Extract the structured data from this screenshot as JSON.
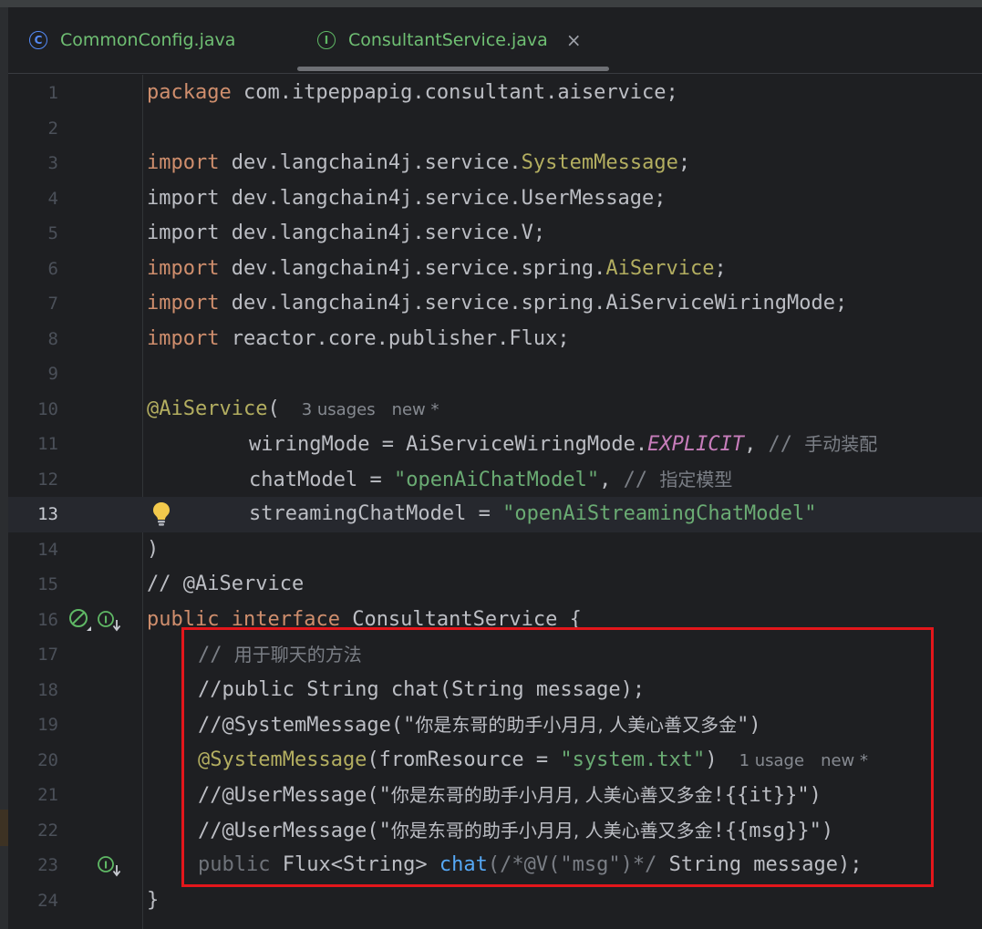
{
  "tabs": [
    {
      "label": "CommonConfig.java",
      "icon": "class-icon",
      "glyph": "C",
      "active": false
    },
    {
      "label": "ConsultantService.java",
      "icon": "interface-icon",
      "glyph": "I",
      "active": true,
      "close": "×"
    }
  ],
  "hints": {
    "line10_usages": "3 usages",
    "line10_new": "new *",
    "line20_usages": "1 usage",
    "line20_new": "new *"
  },
  "lines": [
    {
      "n": "1"
    },
    {
      "n": "2"
    },
    {
      "n": "3"
    },
    {
      "n": "4"
    },
    {
      "n": "5"
    },
    {
      "n": "6"
    },
    {
      "n": "7"
    },
    {
      "n": "8"
    },
    {
      "n": "9"
    },
    {
      "n": "10"
    },
    {
      "n": "11"
    },
    {
      "n": "12"
    },
    {
      "n": "13"
    },
    {
      "n": "14"
    },
    {
      "n": "15"
    },
    {
      "n": "16"
    },
    {
      "n": "17"
    },
    {
      "n": "18"
    },
    {
      "n": "19"
    },
    {
      "n": "20"
    },
    {
      "n": "21"
    },
    {
      "n": "22"
    },
    {
      "n": "23"
    },
    {
      "n": "24"
    }
  ],
  "code": {
    "l1": {
      "kw": "package",
      "rest": " com.itpeppapig.consultant.aiservice;"
    },
    "l3": {
      "kw": "import",
      "pkg": " dev.langchain4j.service.",
      "cls": "SystemMessage",
      "end": ";"
    },
    "l4": {
      "text": "import dev.langchain4j.service.UserMessage;"
    },
    "l5": {
      "text": "import dev.langchain4j.service.V;"
    },
    "l6": {
      "kw": "import",
      "pkg": " dev.langchain4j.service.spring.",
      "cls": "AiService",
      "end": ";"
    },
    "l7": {
      "kw": "import",
      "rest": " dev.langchain4j.service.spring.AiServiceWiringMode;"
    },
    "l8": {
      "kw": "import",
      "rest": " reactor.core.publisher.Flux;"
    },
    "l10": {
      "ann": "@AiService",
      "paren": "("
    },
    "l11": {
      "pre": "wiringMode = AiServiceWiringMode.",
      "field": "EXPLICIT",
      "comma": ",",
      "cmt": " // ",
      "cjk": "手动装配"
    },
    "l12": {
      "pre": "chatModel = ",
      "str": "\"openAiChatModel\"",
      "comma": ",",
      "cmt": " // ",
      "cjk": "指定模型"
    },
    "l13": {
      "pre": "streamingChatModel = ",
      "str": "\"openAiStreamingChatModel\""
    },
    "l14": {
      "text": ")"
    },
    "l15": {
      "text": "// @AiService"
    },
    "l16": {
      "kw1": "public",
      "kw2": "interface",
      "rest": " ConsultantService {"
    },
    "l17": {
      "cmt": "// ",
      "cjk": "用于聊天的方法"
    },
    "l18": {
      "text": "//public String chat(String message);"
    },
    "l19": {
      "pre": "//@SystemMessage(\"",
      "cjk": "你是东哥的助手小月月, 人美心善又多金",
      "post": "\")"
    },
    "l20": {
      "ann": "@SystemMessage",
      "pre": "(fromResource = ",
      "str": "\"system.txt\"",
      "post": ")"
    },
    "l21": {
      "pre": "//@UserMessage(\"",
      "cjk": "你是东哥的助手小月月, 人美心善又多金",
      "post": "!{{it}}\")"
    },
    "l22": {
      "pre": "//@UserMessage(\"",
      "cjk": "你是东哥的助手小月月, 人美心善又多金",
      "post": "!{{msg}}\")"
    },
    "l23": {
      "kw": "public",
      "type": " Flux<String> ",
      "fn": "chat",
      "cmtpart": "(/*@V(\"msg\")*/",
      "rest": " String message);"
    },
    "l24": {
      "text": "}"
    }
  },
  "colors": {
    "keyword": "#cf8e6d",
    "annotation": "#b3ae60",
    "string": "#6aab73",
    "comment": "#7a7e85",
    "field": "#c77dbb",
    "method": "#56a8f5",
    "highlight_box": "#e3161b"
  }
}
